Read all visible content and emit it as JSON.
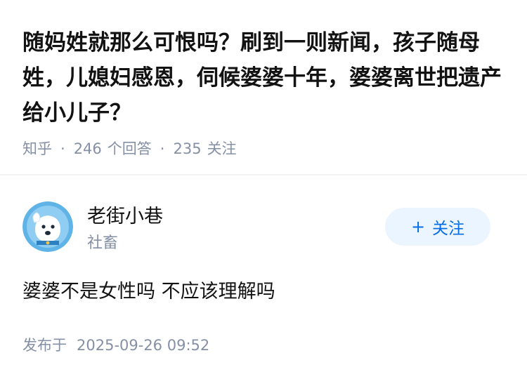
{
  "question": {
    "title": "随妈姓就那么可恨吗？刷到一则新闻，孩子随母姓，儿媳妇感恩，伺候婆婆十年，婆婆离世把遗产给小儿子？",
    "source": "知乎",
    "answer_count": "246",
    "answer_label": "个回答",
    "follower_count": "235",
    "follower_label": "关注"
  },
  "answer": {
    "author_name": "老街小巷",
    "author_badge": "社畜",
    "follow_button": {
      "icon": "plus-icon",
      "label": "关注"
    },
    "content": "婆婆不是女性吗 不应该理解吗",
    "published_label": "发布于",
    "published_time": "2025-09-26 09:52"
  },
  "colors": {
    "primary_text": "#121212",
    "secondary_text": "#8590a6",
    "accent": "#056de8",
    "follow_bg": "#ebf5ff",
    "avatar_bg": "#6cb9ea"
  }
}
